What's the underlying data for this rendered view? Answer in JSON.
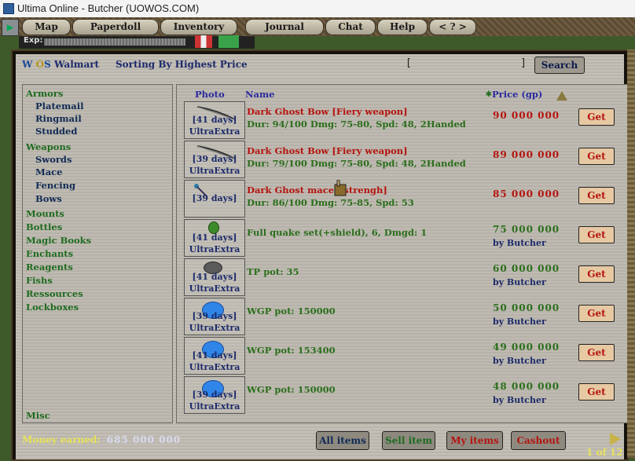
{
  "window": {
    "title": "Ultima Online - Butcher (UOWOS.COM)"
  },
  "top_menu": {
    "items": [
      "Map",
      "Paperdoll",
      "Inventory",
      "Journal",
      "Chat",
      "Help",
      "< ? >"
    ],
    "exp_label": "Exp:"
  },
  "header": {
    "title_w": "W",
    "title_o": "O",
    "title_s": "S",
    "title_rest": "Walmart",
    "sorting": "Sorting By Highest Price",
    "search_open": "[",
    "search_close": "]",
    "search_button": "Search"
  },
  "categories": [
    {
      "label": "Armors",
      "sub": false
    },
    {
      "label": "Platemail",
      "sub": true
    },
    {
      "label": "Ringmail",
      "sub": true
    },
    {
      "label": "Studded",
      "sub": true
    },
    {
      "label": "Weapons",
      "sub": false
    },
    {
      "label": "Swords",
      "sub": true
    },
    {
      "label": "Mace",
      "sub": true
    },
    {
      "label": "Fencing",
      "sub": true
    },
    {
      "label": "Bows",
      "sub": true
    },
    {
      "label": "Mounts",
      "sub": false
    },
    {
      "label": "Bottles",
      "sub": false
    },
    {
      "label": "Magic Books",
      "sub": false
    },
    {
      "label": "Enchants",
      "sub": false
    },
    {
      "label": "Reagents",
      "sub": false
    },
    {
      "label": "Fishs",
      "sub": false
    },
    {
      "label": "Ressources",
      "sub": false
    },
    {
      "label": "Lockboxes",
      "sub": false
    }
  ],
  "misc_label": "Misc",
  "columns": {
    "photo": "Photo",
    "name": "Name",
    "star": "✱",
    "price": "Price (gp)"
  },
  "listings": [
    {
      "days": "[41 days]",
      "tag": "UltraExtra",
      "name": "Dark Ghost Bow [Fiery weapon]",
      "stats": "Dur: 94/100 Dmg: 75-80, Spd: 48, 2Handed",
      "price": "90 000 000",
      "seller": "",
      "get": "Get",
      "style": "red",
      "icon": "bow"
    },
    {
      "days": "[39 days]",
      "tag": "UltraExtra",
      "name": "Dark Ghost Bow [Fiery weapon]",
      "stats": "Dur: 79/100 Dmg: 75-80, Spd: 48, 2Handed",
      "price": "89 000 000",
      "seller": "",
      "get": "Get",
      "style": "red",
      "icon": "bow"
    },
    {
      "days": "[39 days]",
      "tag": "",
      "name": "Dark Ghost mace  l strengh]",
      "stats": "Dur: 86/100 Dmg: 75-85, Spd: 53",
      "price": "85 000 000",
      "seller": "",
      "get": "Get",
      "style": "red",
      "icon": "mace"
    },
    {
      "days": "[41 days]",
      "tag": "UltraExtra",
      "name": "Full quake set(+shield), 6, Dmgd: 1",
      "stats": "",
      "price": "75 000 000",
      "seller": "by Butcher",
      "get": "Get",
      "style": "green",
      "icon": "pouch"
    },
    {
      "days": "[41 days]",
      "tag": "UltraExtra",
      "name": "TP pot: 35",
      "stats": "",
      "price": "60 000 000",
      "seller": "by Butcher",
      "get": "Get",
      "style": "green",
      "icon": "stone"
    },
    {
      "days": "[39 days]",
      "tag": "UltraExtra",
      "name": "WGP pot: 150000",
      "stats": "",
      "price": "50 000 000",
      "seller": "by Butcher",
      "get": "Get",
      "style": "green",
      "icon": "potion"
    },
    {
      "days": "[41 days]",
      "tag": "UltraExtra",
      "name": "WGP pot: 153400",
      "stats": "",
      "price": "49 000 000",
      "seller": "by Butcher",
      "get": "Get",
      "style": "green",
      "icon": "potion"
    },
    {
      "days": "[39 days]",
      "tag": "UltraExtra",
      "name": "WGP pot: 150000",
      "stats": "",
      "price": "48 000 000",
      "seller": "by Butcher",
      "get": "Get",
      "style": "green",
      "icon": "potion"
    }
  ],
  "footer": {
    "money_label": "Money earned:",
    "money_value": "685 000 000",
    "buttons": [
      "All items",
      "Sell item",
      "My items",
      "Cashout"
    ],
    "pager": "1 of 12"
  },
  "colors": {
    "red": "#b5130e",
    "green": "#2b6e1c",
    "navy": "#1c2a6a",
    "yellow": "#e7e25a"
  }
}
